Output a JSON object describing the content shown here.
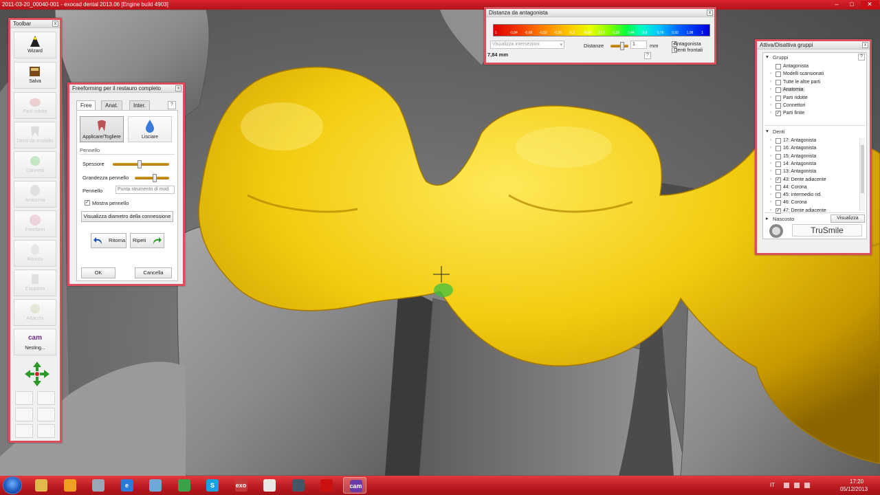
{
  "window": {
    "title": "2011-03-20_00040-001 - exocad dental 2013.06 [Engine build 4903]",
    "minimize": "–",
    "maximize": "□",
    "close": "✕"
  },
  "toolbar": {
    "title": "Toolbar",
    "close": "x",
    "buttons": [
      {
        "label": "Wizard",
        "icon": "wizard-hat-icon",
        "enabled": true
      },
      {
        "label": "Salva",
        "icon": "save-book-icon",
        "enabled": true
      },
      {
        "label": "Parti ridotte",
        "icon": "reduced-parts-icon",
        "enabled": false
      },
      {
        "label": "Denti da modello",
        "icon": "tooth-model-icon",
        "enabled": false
      },
      {
        "label": "Connetti",
        "icon": "connect-icon",
        "enabled": false
      },
      {
        "label": "Anatomia",
        "icon": "anatomy-icon",
        "enabled": false
      },
      {
        "label": "Freeform",
        "icon": "freeform-icon",
        "enabled": false
      },
      {
        "label": "Ritocco",
        "icon": "retouch-icon",
        "enabled": false
      },
      {
        "label": "Cappetta",
        "icon": "coping-icon",
        "enabled": false
      },
      {
        "label": "Attacchi",
        "icon": "attachment-icon",
        "enabled": false
      },
      {
        "label": "Nesting...",
        "icon": "cam-icon",
        "enabled": true,
        "icon_text": "cam"
      }
    ]
  },
  "freeform": {
    "title": "Freeforming per il restauro completo",
    "close": "x",
    "tabs": [
      "Free",
      "Anat.",
      "Inter."
    ],
    "help": "?",
    "apply_label": "Applicare/Togliere",
    "smooth_label": "Lisciare",
    "section_brush": "Pennello",
    "thickness_label": "Spessore",
    "thickness_level": 0.47,
    "brush_size_label": "Grandezza pennello",
    "brush_size_level": 0.6,
    "brush_label": "Pennello",
    "brush_value": "Punta strumento di mod",
    "show_brush_label": "Mostra pennello",
    "show_brush_checked": true,
    "connection_button": "Visualizza diametro della connessione",
    "undo_label": "Ritorna",
    "redo_label": "Ripeti",
    "ok_label": "OK",
    "cancel_label": "Cancella"
  },
  "distanza": {
    "title": "Distanza da antagonista",
    "close": "x",
    "scale_ticks": [
      "1",
      "-0,84",
      "-0,68",
      "-0,52",
      "-0,36",
      "-0,2",
      "-0,04",
      "0,12",
      "0,28",
      "0,44",
      "0,6",
      "0,76",
      "0,92",
      "1,08",
      "1"
    ],
    "display_value": "Visualizza intersezioni",
    "distance_label": "Distanze",
    "distance_value": "1",
    "unit": "mm",
    "opt1_label": "Antagonista",
    "opt1_checked": true,
    "opt2_label": "Denti frontali",
    "opt2_checked": false,
    "reading": "7,84 mm",
    "help": "?"
  },
  "groups": {
    "title": "Attiva/Disattiva gruppi",
    "close": "x",
    "help": "?",
    "section_groups": "Gruppi",
    "groups": [
      {
        "label": "Antagonista",
        "checked": false,
        "expand": ""
      },
      {
        "label": "Modelli scansionati",
        "checked": false,
        "expand": "›"
      },
      {
        "label": "Tutte le altre parti",
        "checked": false,
        "expand": "›"
      },
      {
        "label": "Anatomia",
        "checked": false,
        "expand": "›",
        "highlight": true
      },
      {
        "label": "Parti ridotte",
        "checked": false,
        "expand": "›"
      },
      {
        "label": "Connettori",
        "checked": false,
        "expand": "›"
      },
      {
        "label": "Parti finite",
        "checked": true,
        "expand": "›"
      }
    ],
    "section_teeth": "Denti",
    "teeth": [
      {
        "label": "17: Antagonista",
        "checked": false
      },
      {
        "label": "16: Antagonista",
        "checked": false
      },
      {
        "label": "15: Antagonista",
        "checked": false
      },
      {
        "label": "14: Antagonista",
        "checked": false
      },
      {
        "label": "13: Antagonista",
        "checked": false
      },
      {
        "label": "43: Dente adiacente",
        "checked": true
      },
      {
        "label": "44: Corona",
        "checked": false
      },
      {
        "label": "45: intermedio rid.",
        "checked": false
      },
      {
        "label": "46: Corona",
        "checked": false
      },
      {
        "label": "47: Dente adiacente",
        "checked": true
      }
    ],
    "section_hidden": "Nascosto",
    "show_button": "Visualizza",
    "brand": "TruSmile"
  },
  "taskbar": {
    "apps": [
      {
        "name": "file-explorer",
        "label": "",
        "color": "#e2b94b"
      },
      {
        "name": "media-player",
        "label": "",
        "color": "#f0a020"
      },
      {
        "name": "tools",
        "label": "",
        "color": "#9aa7b4"
      },
      {
        "name": "internet-explorer",
        "label": "e",
        "color": "#2a7ad6"
      },
      {
        "name": "notepad",
        "label": "",
        "color": "#6fa8d8"
      },
      {
        "name": "chrome",
        "label": "",
        "color": "#3aa34a"
      },
      {
        "name": "skype",
        "label": "S",
        "color": "#1aa2e0"
      },
      {
        "name": "exocad",
        "label": "exo",
        "color": "#c43a3a"
      },
      {
        "name": "tooth-app",
        "label": "",
        "color": "#e8e8e8"
      },
      {
        "name": "video-app",
        "label": "",
        "color": "#445566"
      },
      {
        "name": "recorder",
        "label": "",
        "color": "#cc1111"
      },
      {
        "name": "cam-app",
        "label": "cam",
        "color": "#6a3aa8"
      }
    ],
    "active_index": 11,
    "language": "IT",
    "time": "17:20",
    "date": "05/12/2013"
  }
}
